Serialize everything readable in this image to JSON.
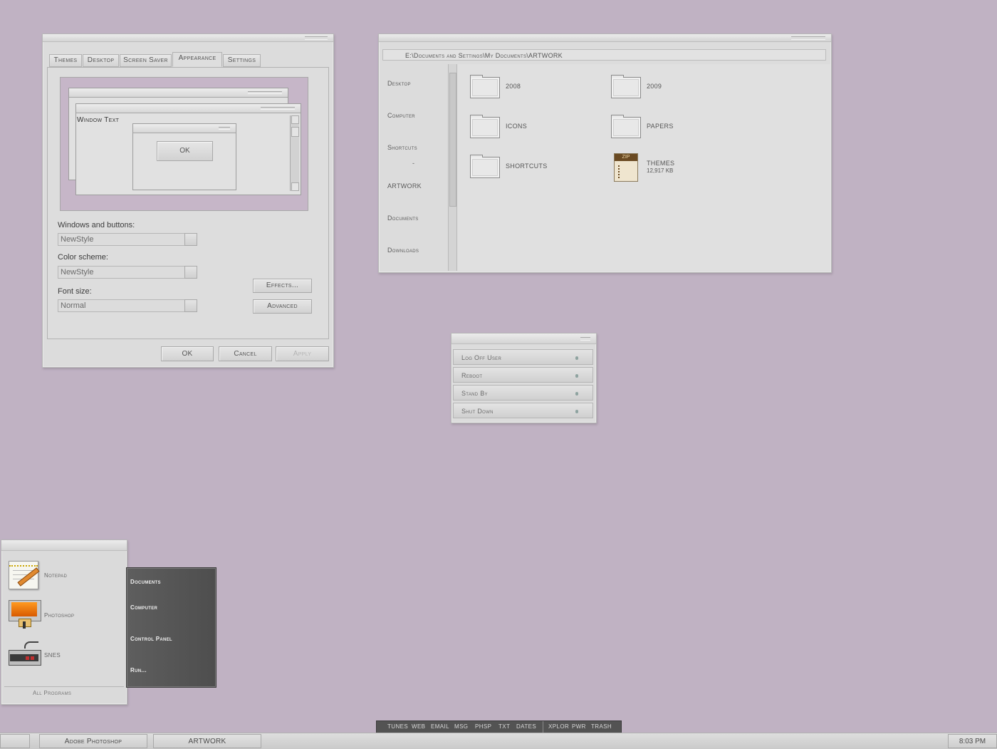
{
  "display_properties": {
    "tabs": [
      "Themes",
      "Desktop",
      "Screen Saver",
      "Appearance",
      "Settings"
    ],
    "active_tab": "Appearance",
    "preview": {
      "window_text": "Window Text",
      "ok_label": "OK"
    },
    "windows_buttons": {
      "label": "Windows and buttons:",
      "value": "NewStyle"
    },
    "color_scheme": {
      "label": "Color scheme:",
      "value": "NewStyle"
    },
    "font_size": {
      "label": "Font size:",
      "value": "Normal"
    },
    "effects_label": "Effects...",
    "advanced_label": "Advanced",
    "ok_label": "OK",
    "cancel_label": "Cancel",
    "apply_label": "Apply"
  },
  "explorer": {
    "address": "E:\\Documents and Settings\\My Documents\\ARTWORK",
    "sidebar": [
      "Desktop",
      "Computer",
      "Shortcuts",
      "-",
      "ARTWORK",
      "Documents",
      "Downloads"
    ],
    "items": [
      {
        "name": "2008",
        "type": "folder"
      },
      {
        "name": "2009",
        "type": "folder"
      },
      {
        "name": "ICONS",
        "type": "folder"
      },
      {
        "name": "PAPERS",
        "type": "folder"
      },
      {
        "name": "SHORTCUTS",
        "type": "folder"
      },
      {
        "name": "THEMES",
        "type": "zip",
        "size": "12,917 KB",
        "badge": "ZIP"
      }
    ]
  },
  "shutdown_menu": [
    "Log Off User",
    "Reboot",
    "Stand By",
    "Shut Down"
  ],
  "start_menu": {
    "programs": [
      "Notepad",
      "Photoshop",
      "SNES"
    ],
    "all_programs": "All Programs",
    "places": [
      "Documents",
      "Computer",
      "Control Panel",
      "Run..."
    ]
  },
  "dock": {
    "group1": [
      "TUNES",
      "WEB",
      "EMAIL",
      "MSG",
      "PHSP",
      "TXT",
      "DATES"
    ],
    "group2": [
      "XPLOR",
      "PWR",
      "TRASH"
    ]
  },
  "taskbar": {
    "tasks": [
      "Adobe Photoshop",
      "ARTWORK"
    ],
    "clock": "8:03 PM"
  },
  "colors": {
    "desktop": "#c0b2c3",
    "window": "#dcdcdc",
    "dark_panel": "#555555"
  }
}
